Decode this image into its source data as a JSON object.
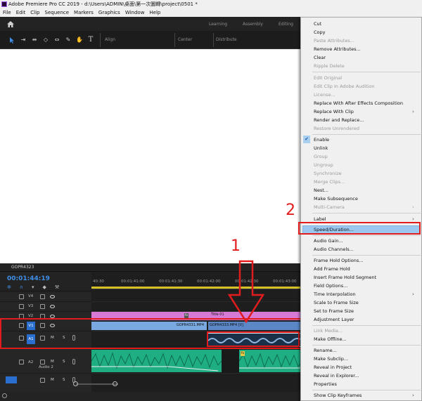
{
  "window": {
    "title": "Adobe Premiere Pro CC 2019 - d:\\Users\\ADMIN\\桌面\\第一次圖轉\\project\\0501 *"
  },
  "menu_bar": [
    "File",
    "Edit",
    "Clip",
    "Sequence",
    "Markers",
    "Graphics",
    "Window",
    "Help"
  ],
  "workspaces": [
    "Learning",
    "Assembly",
    "Editing"
  ],
  "toolbar": {
    "align_label": "Align",
    "center_label": "Center",
    "distribute_label": "Distribute",
    "tools": [
      "selection-tool",
      "track-select-tool",
      "ripple-edit-tool",
      "razor-tool",
      "slip-tool",
      "pen-tool",
      "hand-tool",
      "type-tool"
    ]
  },
  "timeline": {
    "sequence_name": "GOPR4323",
    "timecode": "00:01:44:19",
    "ruler_ticks": [
      "40:30",
      "00:01:41:00",
      "00:01:41:30",
      "00:01:42:00",
      "00:01:42:30",
      "00:01:43:00"
    ],
    "tracks": [
      {
        "id": "V4",
        "kind": "video"
      },
      {
        "id": "V3",
        "kind": "video"
      },
      {
        "id": "V2",
        "kind": "video"
      },
      {
        "id": "V1",
        "kind": "video",
        "source": "V1"
      },
      {
        "id": "A1",
        "kind": "audio",
        "source": "A1"
      },
      {
        "id": "A2",
        "kind": "audio",
        "name": "Audio 2"
      }
    ],
    "track_button_labels": {
      "mute": "M",
      "solo": "S"
    },
    "clips": {
      "fx_v2": "fx",
      "title": "Title 01",
      "video_a": "GOPR4331.MP4",
      "video_b": "GOPR4333.MP4 [V]",
      "audio_fx": "fx"
    }
  },
  "context_menu": {
    "items": [
      {
        "label": "Cut",
        "enabled": true
      },
      {
        "label": "Copy",
        "enabled": true
      },
      {
        "label": "Paste Attributes...",
        "enabled": false
      },
      {
        "label": "Remove Attributes...",
        "enabled": true
      },
      {
        "label": "Clear",
        "enabled": true
      },
      {
        "label": "Ripple Delete",
        "enabled": false
      },
      {
        "label": "Edit Original",
        "enabled": false
      },
      {
        "label": "Edit Clip In Adobe Audition",
        "enabled": false
      },
      {
        "label": "License...",
        "enabled": false
      },
      {
        "label": "Replace With After Effects Composition",
        "enabled": true
      },
      {
        "label": "Replace With Clip",
        "enabled": true,
        "submenu": true
      },
      {
        "label": "Render and Replace...",
        "enabled": true
      },
      {
        "label": "Restore Unrendered",
        "enabled": false
      },
      {
        "label": "Enable",
        "enabled": true,
        "checked": true
      },
      {
        "label": "Unlink",
        "enabled": true
      },
      {
        "label": "Group",
        "enabled": false
      },
      {
        "label": "Ungroup",
        "enabled": false
      },
      {
        "label": "Synchronize",
        "enabled": false
      },
      {
        "label": "Merge Clips...",
        "enabled": false
      },
      {
        "label": "Nest...",
        "enabled": true
      },
      {
        "label": "Make Subsequence",
        "enabled": true
      },
      {
        "label": "Multi-Camera",
        "enabled": false,
        "submenu": true
      },
      {
        "label": "Label",
        "enabled": true,
        "submenu": true
      },
      {
        "label": "Speed/Duration...",
        "enabled": true,
        "highlighted": true
      },
      {
        "label": "Audio Gain...",
        "enabled": true
      },
      {
        "label": "Audio Channels...",
        "enabled": true
      },
      {
        "label": "Frame Hold Options...",
        "enabled": true
      },
      {
        "label": "Add Frame Hold",
        "enabled": true
      },
      {
        "label": "Insert Frame Hold Segment",
        "enabled": true
      },
      {
        "label": "Field Options...",
        "enabled": true
      },
      {
        "label": "Time Interpolation",
        "enabled": true,
        "submenu": true
      },
      {
        "label": "Scale to Frame Size",
        "enabled": true
      },
      {
        "label": "Set to Frame Size",
        "enabled": true
      },
      {
        "label": "Adjustment Layer",
        "enabled": true
      },
      {
        "label": "Link Media...",
        "enabled": false
      },
      {
        "label": "Make Offline...",
        "enabled": true
      },
      {
        "label": "Rename...",
        "enabled": true
      },
      {
        "label": "Make Subclip...",
        "enabled": true
      },
      {
        "label": "Reveal in Project",
        "enabled": true
      },
      {
        "label": "Reveal in Explorer...",
        "enabled": true
      },
      {
        "label": "Properties",
        "enabled": true
      },
      {
        "label": "Show Clip Keyframes",
        "enabled": true,
        "submenu": true
      }
    ]
  },
  "annotations": [
    "1",
    "2"
  ],
  "colors": {
    "accent": "#2a6fd0",
    "annotation": "#e21c1c",
    "menu_highlight": "#9cc8ef",
    "timecode": "#3f8fe8",
    "title_clip": "#d67ad6",
    "video_clip": "#7aa8e0",
    "audio_clip": "#1fae82"
  }
}
